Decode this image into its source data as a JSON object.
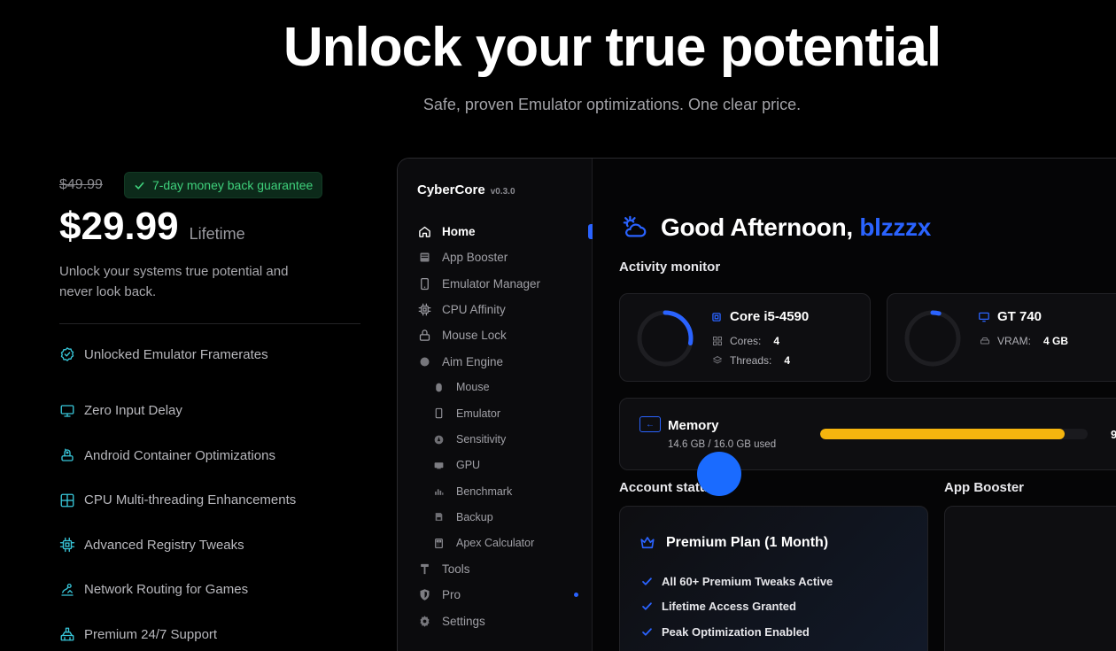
{
  "hero": {
    "title": "Unlock your true potential",
    "subtitle": "Safe, proven Emulator optimizations. One clear price."
  },
  "pricing": {
    "old_price": "$49.99",
    "guarantee": "7-day money back guarantee",
    "price": "$29.99",
    "term": "Lifetime",
    "description": "Unlock your systems true potential and never look back.",
    "features": [
      {
        "label": "Unlocked Emulator Framerates",
        "icon": "shield-check-icon"
      },
      {
        "label": "Zero Input Delay",
        "icon": "monitor-icon"
      },
      {
        "label": "Android Container Optimizations",
        "icon": "android-icon"
      },
      {
        "label": "CPU Multi-threading Enhancements",
        "icon": "grid-icon"
      },
      {
        "label": "Advanced Registry Tweaks",
        "icon": "chip-icon"
      },
      {
        "label": "Network Routing for Games",
        "icon": "route-icon"
      },
      {
        "label": "Premium 24/7 Support",
        "icon": "support-icon"
      }
    ],
    "accent": "#38c6d9"
  },
  "app": {
    "brand": "CyberCore",
    "version": "v0.3.0",
    "nav": [
      {
        "label": "Home",
        "icon": "home-icon",
        "active": true
      },
      {
        "label": "App Booster",
        "icon": "booster-icon"
      },
      {
        "label": "Emulator Manager",
        "icon": "phone-icon"
      },
      {
        "label": "CPU Affinity",
        "icon": "cpu-icon"
      },
      {
        "label": "Mouse Lock",
        "icon": "lock-icon"
      },
      {
        "label": "Aim Engine",
        "icon": "aim-icon"
      },
      {
        "label": "Mouse",
        "icon": "mouse-icon",
        "sub": true
      },
      {
        "label": "Emulator",
        "icon": "phone-icon",
        "sub": true
      },
      {
        "label": "Sensitivity",
        "icon": "sensitivity-icon",
        "sub": true
      },
      {
        "label": "GPU",
        "icon": "gpu-icon",
        "sub": true
      },
      {
        "label": "Benchmark",
        "icon": "benchmark-icon",
        "sub": true
      },
      {
        "label": "Backup",
        "icon": "backup-icon",
        "sub": true
      },
      {
        "label": "Apex Calculator",
        "icon": "calculator-icon",
        "sub": true
      },
      {
        "label": "Tools",
        "icon": "hammer-icon"
      },
      {
        "label": "Pro",
        "icon": "shield-icon",
        "dot": true
      },
      {
        "label": "Settings",
        "icon": "gear-icon"
      }
    ],
    "greeting": "Good Afternoon,",
    "username": "blzzzx",
    "activity_label": "Activity monitor",
    "cpu": {
      "name": "Core i5-4590",
      "cores_label": "Cores:",
      "cores": "4",
      "threads_label": "Threads:",
      "threads": "4",
      "usage": 0.28
    },
    "gpu": {
      "name": "GT 740",
      "vram_label": "VRAM:",
      "vram": "4 GB",
      "usage": 0.04
    },
    "memory": {
      "title": "Memory",
      "detail": "14.6 GB / 16.0 GB used",
      "fraction": 0.913,
      "percent_partial": "9"
    },
    "account_label": "Account status",
    "booster_label": "App Booster",
    "plan": {
      "title": "Premium Plan (1 Month)",
      "items": [
        "All 60+ Premium Tweaks Active",
        "Lifetime Access Granted",
        "Peak Optimization Enabled"
      ]
    },
    "accent": "#2a63ff",
    "memory_color": "#f5b50e"
  }
}
